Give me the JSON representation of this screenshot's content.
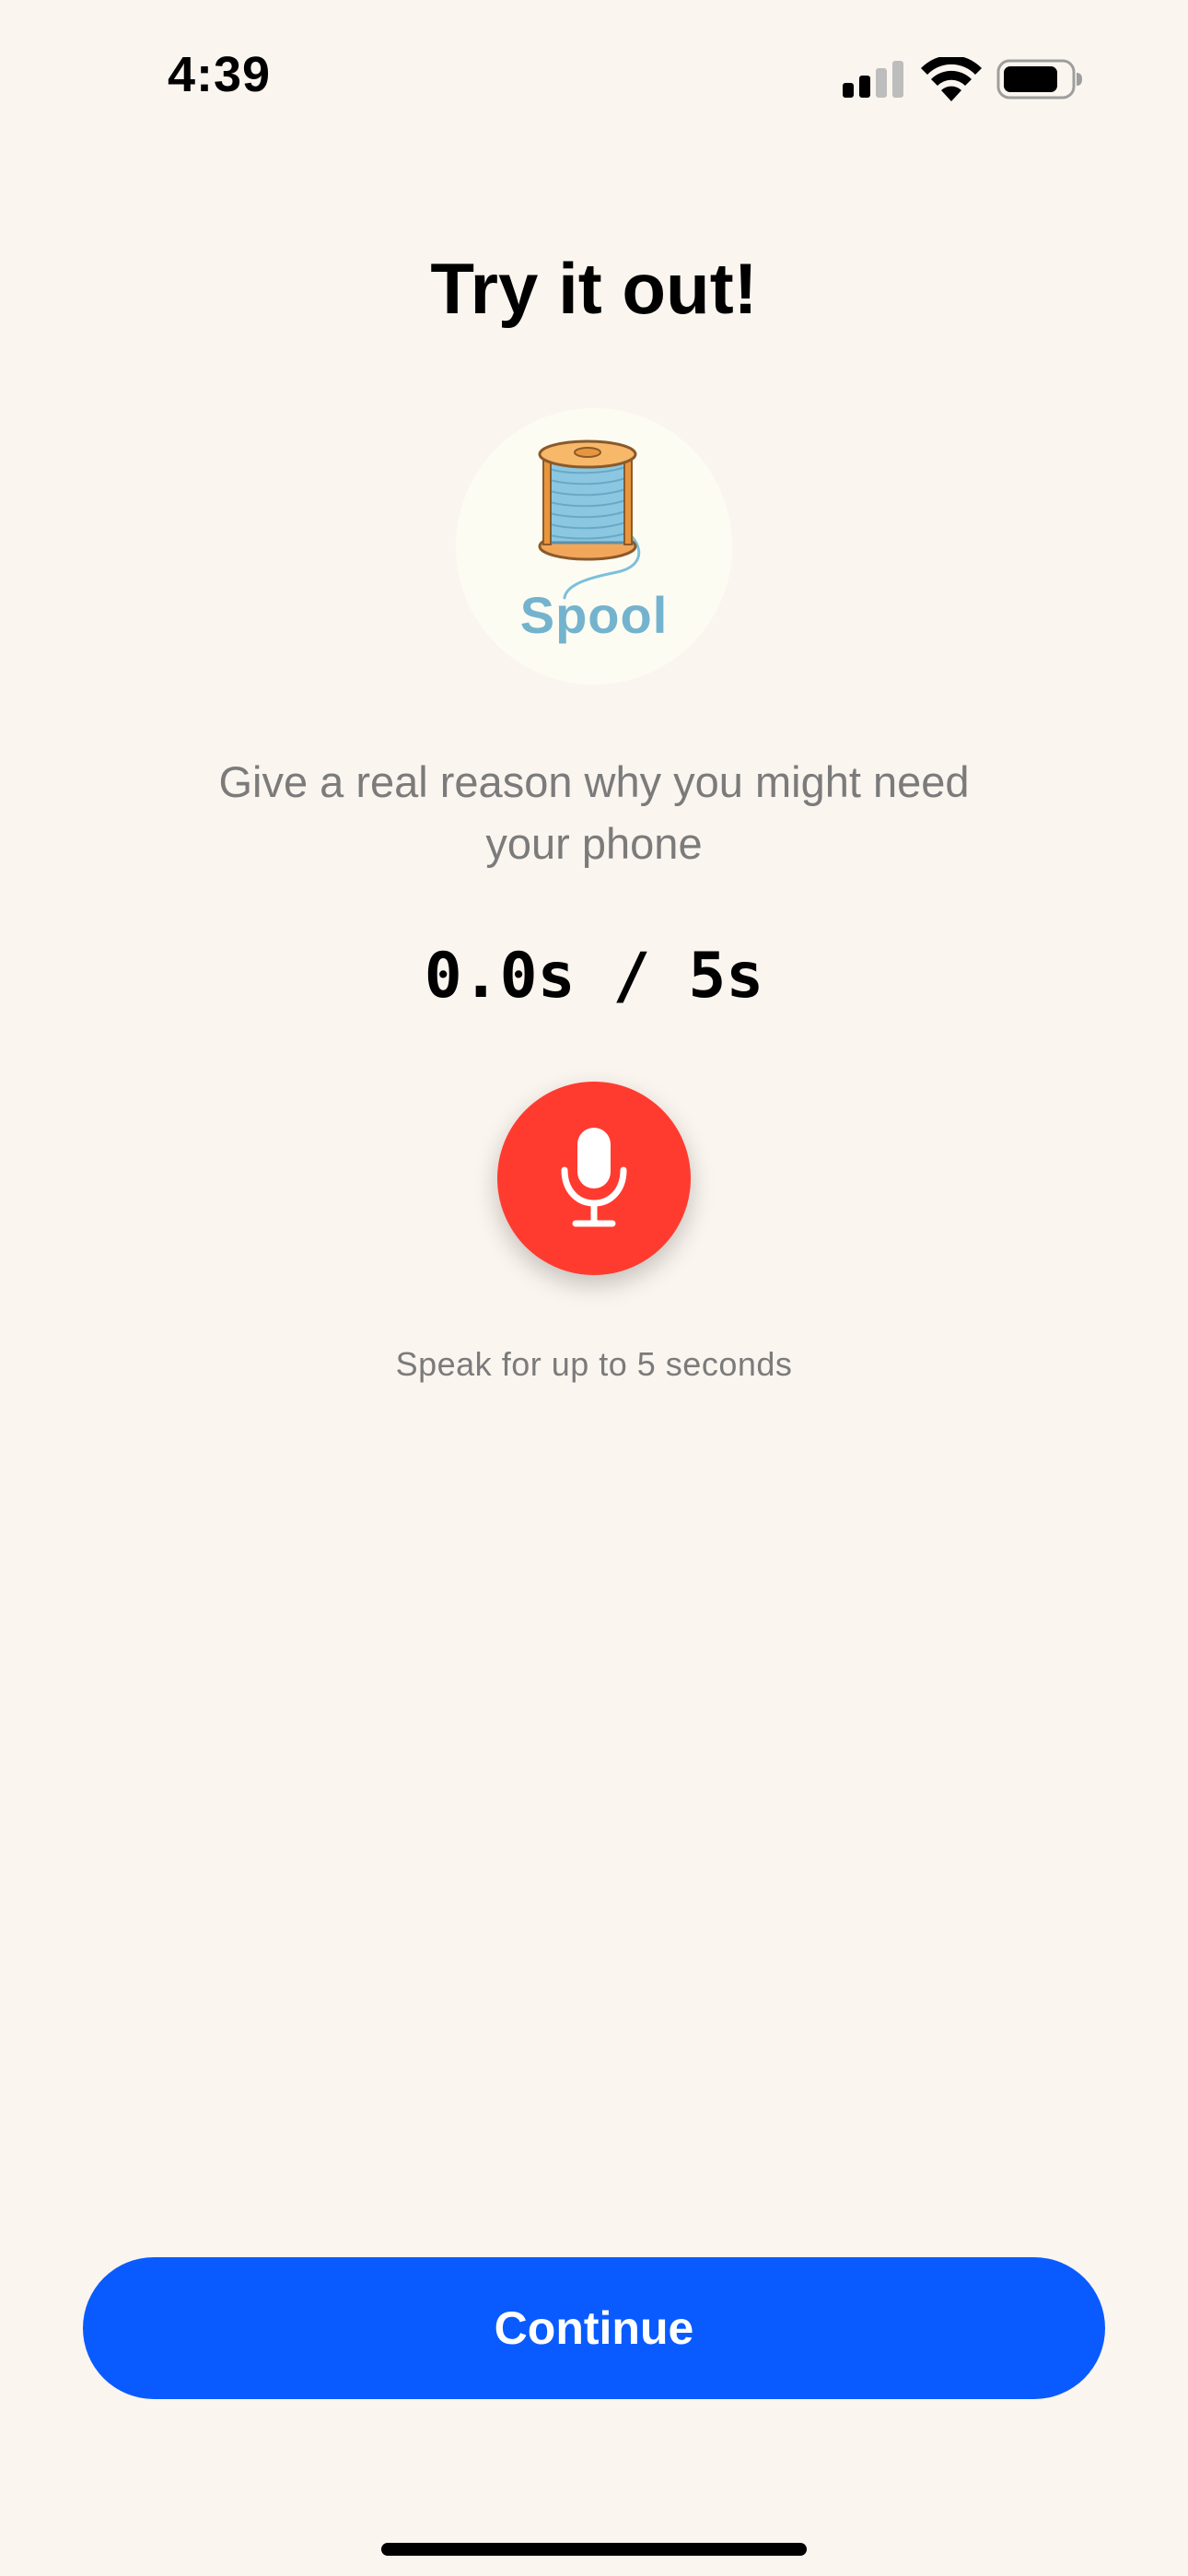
{
  "status_bar": {
    "time": "4:39"
  },
  "icons": {
    "signal": "cellular-signal-icon",
    "wifi": "wifi-icon",
    "battery": "battery-icon",
    "mic": "microphone-icon"
  },
  "screen": {
    "title": "Try it out!",
    "logo_text": "Spool",
    "prompt": "Give a real reason why you might need your phone",
    "timer": {
      "elapsed": "0.0s",
      "separator": " / ",
      "limit": "5s"
    },
    "hint": "Speak for up to 5 seconds",
    "continue_label": "Continue"
  },
  "colors": {
    "background": "#FBF5EF",
    "record_button": "#FF3B30",
    "continue_button": "#0A5BFF",
    "secondary_text": "#7B7B7B",
    "logo_text": "#74B3CE"
  }
}
